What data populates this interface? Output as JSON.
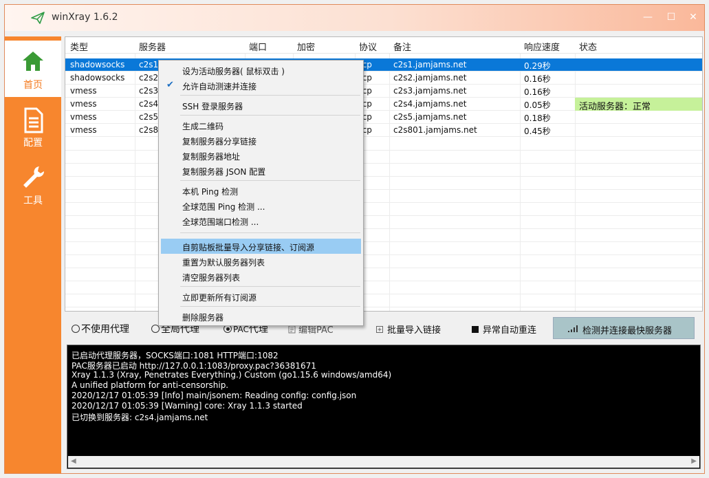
{
  "window": {
    "title": "winXray 1.6.2",
    "accent": "#f7862e",
    "select_color": "#0a78d8"
  },
  "title_controls": {
    "minimize": "—",
    "maximize": "☐",
    "close": "✕"
  },
  "sidebar": {
    "items": [
      {
        "label": "首页",
        "icon": "home-icon"
      },
      {
        "label": "配置",
        "icon": "document-icon"
      },
      {
        "label": "工具",
        "icon": "wrench-icon"
      }
    ]
  },
  "table": {
    "columns": [
      "类型",
      "服务器",
      "端口",
      "加密",
      "协议",
      "备注",
      "响应速度",
      "状态"
    ],
    "rows": [
      {
        "type": "shadowsocks",
        "server": "c2s1",
        "protocol": "tcp",
        "remark": "c2s1.jamjams.net",
        "speed": "0.29秒",
        "status": ""
      },
      {
        "type": "shadowsocks",
        "server": "c2s2",
        "protocol": "tcp",
        "remark": "c2s2.jamjams.net",
        "speed": "0.16秒",
        "status": ""
      },
      {
        "type": "vmess",
        "server": "c2s3",
        "protocol": "tcp",
        "remark": "c2s3.jamjams.net",
        "speed": "0.16秒",
        "status": ""
      },
      {
        "type": "vmess",
        "server": "c2s4",
        "protocol": "tcp",
        "remark": "c2s4.jamjams.net",
        "speed": "0.05秒",
        "status": "活动服务器：正常"
      },
      {
        "type": "vmess",
        "server": "c2s5",
        "protocol": "tcp",
        "remark": "c2s5.jamjams.net",
        "speed": "0.18秒",
        "status": ""
      },
      {
        "type": "vmess",
        "server": "c2s8",
        "protocol": "tcp",
        "remark": "c2s801.jamjams.net",
        "speed": "0.45秒",
        "status": ""
      }
    ]
  },
  "context_menu": {
    "items": [
      "设为活动服务器( 鼠标双击 )",
      "允许自动测速并连接",
      "SSH 登录服务器",
      "生成二维码",
      "复制服务器分享链接",
      "复制服务器地址",
      "复制服务器 JSON 配置",
      "本机 Ping 检测",
      "全球范围 Ping 检测 ...",
      "全球范围端口检测 ...",
      "自剪贴板批量导入分享链接、订阅源",
      "重置为默认服务器列表",
      "清空服务器列表",
      "立即更新所有订阅源",
      "删除服务器"
    ]
  },
  "controls": {
    "no_proxy": "不使用代理",
    "global_proxy": "全局代理",
    "pac_prefix": "PAC",
    "pac_suffix": "代理",
    "edit_pac": "编辑PAC",
    "batch_import": "批量导入链接",
    "auto_reconnect": "异常自动重连",
    "fastest_button": "检测并连接最快服务器"
  },
  "log": {
    "lines": [
      "已启动代理服务器，SOCKS端口:1081 HTTP端口:1082",
      "PAC服务器已启动    http://127.0.0.1:1083/proxy.pac?36381671",
      "Xray 1.1.3 (Xray, Penetrates Everything.) Custom (go1.15.6 windows/amd64)",
      "A unified platform for anti-censorship.",
      "2020/12/17 01:05:39 [Info] main/jsonem: Reading config: config.json",
      "2020/12/17 01:05:39 [Warning] core: Xray 1.1.3 started",
      "已切换到服务器:    c2s4.jamjams.net"
    ]
  }
}
